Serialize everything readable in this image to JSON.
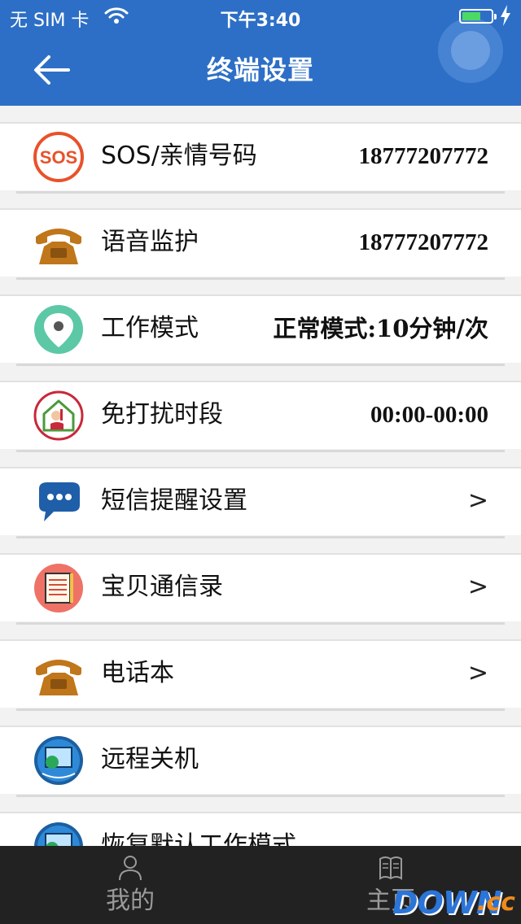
{
  "status_bar": {
    "carrier": "无 SIM 卡",
    "time": "下午3:40",
    "battery_color": "#4cd964"
  },
  "header": {
    "title": "终端设置",
    "back_icon": "arrow-left-icon",
    "background": "#2d6fc6"
  },
  "list": {
    "items": [
      {
        "label": "SOS/亲情号码",
        "value": "18777207772",
        "icon": "sos-icon"
      },
      {
        "label": "语音监护",
        "value": "18777207772",
        "icon": "telephone-icon"
      },
      {
        "label": "工作模式",
        "value": "正常模式:10分钟/次",
        "icon": "location-pin-icon"
      },
      {
        "label": "免打扰时段",
        "value": "00:00-00:00",
        "icon": "do-not-disturb-house-icon"
      },
      {
        "label": "短信提醒设置",
        "arrow": ">",
        "icon": "chat-bubble-icon"
      },
      {
        "label": "宝贝通信录",
        "arrow": ">",
        "icon": "notebook-icon"
      },
      {
        "label": "电话本",
        "arrow": ">",
        "icon": "telephone-icon"
      },
      {
        "label": "远程关机",
        "icon": "monitor-globe-icon"
      },
      {
        "label": "恢复默认工作模式",
        "icon": "monitor-globe-icon"
      }
    ]
  },
  "tabbar": {
    "tabs": [
      {
        "label": "我的",
        "icon": "person-icon"
      },
      {
        "label": "主页",
        "icon": "book-icon"
      }
    ]
  },
  "watermark": {
    "text_main": "DOWN",
    "text_suffix": ".cc"
  }
}
